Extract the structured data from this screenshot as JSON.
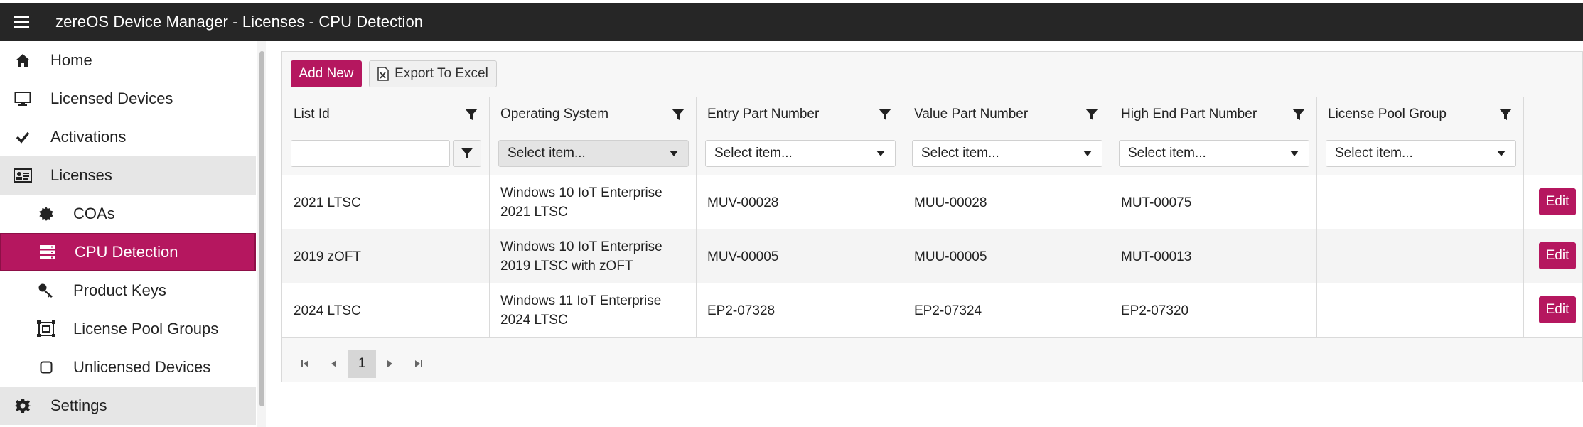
{
  "window": {
    "title": "zereOS Device Manager - Licenses - CPU Detection"
  },
  "sidebar": {
    "items": [
      {
        "label": "Home",
        "icon": "home-icon"
      },
      {
        "label": "Licensed Devices",
        "icon": "monitor-icon"
      },
      {
        "label": "Activations",
        "icon": "checkmark-icon"
      },
      {
        "label": "Licenses",
        "icon": "id-card-icon"
      },
      {
        "label": "COAs",
        "icon": "certificate-seal-icon"
      },
      {
        "label": "CPU Detection",
        "icon": "server-icon"
      },
      {
        "label": "Product Keys",
        "icon": "key-icon"
      },
      {
        "label": "License Pool Groups",
        "icon": "pool-group-icon"
      },
      {
        "label": "Unlicensed Devices",
        "icon": "square-outline-icon"
      },
      {
        "label": "Settings",
        "icon": "gear-icon"
      }
    ]
  },
  "toolbar": {
    "add_label": "Add New",
    "export_label": "Export To Excel"
  },
  "grid": {
    "columns": [
      "List Id",
      "Operating System",
      "Entry Part Number",
      "Value Part Number",
      "High End Part Number",
      "License Pool Group"
    ],
    "filter_placeholder": "Select item...",
    "rows": [
      {
        "list_id": "2021 LTSC",
        "os": "Windows 10 IoT Enterprise\n2021 LTSC",
        "entry": "MUV-00028",
        "value": "MUU-00028",
        "high": "MUT-00075",
        "pool": "",
        "action": "Edit"
      },
      {
        "list_id": "2019 zOFT",
        "os": "Windows 10 IoT Enterprise\n2019 LTSC with zOFT",
        "entry": "MUV-00005",
        "value": "MUU-00005",
        "high": "MUT-00013",
        "pool": "",
        "action": "Edit"
      },
      {
        "list_id": "2024 LTSC",
        "os": "Windows 11 IoT Enterprise\n2024 LTSC",
        "entry": "EP2-07328",
        "value": "EP2-07324",
        "high": "EP2-07320",
        "pool": "",
        "action": "Edit"
      }
    ]
  },
  "pager": {
    "current_page": "1"
  },
  "colors": {
    "accent": "#b5175f",
    "topbar": "#262626"
  }
}
